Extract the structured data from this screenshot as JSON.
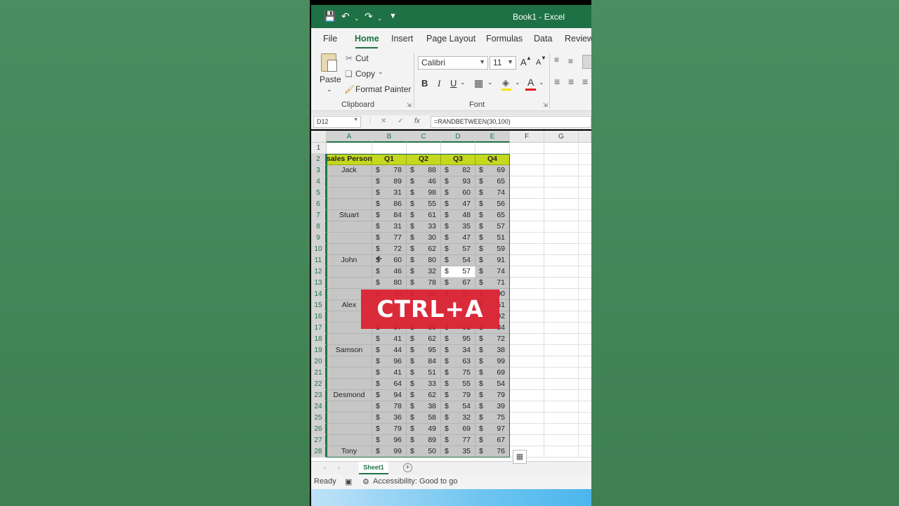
{
  "window": {
    "title": "Book1  -  Excel"
  },
  "quick_access": {
    "save_icon": "save-icon",
    "undo_icon": "undo-icon",
    "redo_icon": "redo-icon",
    "customize_icon": "customize-icon"
  },
  "tabs": [
    "File",
    "Home",
    "Insert",
    "Page Layout",
    "Formulas",
    "Data",
    "Review"
  ],
  "active_tab": "Home",
  "ribbon": {
    "clipboard": {
      "paste": "Paste",
      "cut": "Cut",
      "copy": "Copy",
      "format_painter": "Format Painter",
      "label": "Clipboard"
    },
    "font": {
      "font_name": "Calibri",
      "font_size": "11",
      "bold": "B",
      "italic": "I",
      "underline": "U",
      "grow": "A",
      "shrink": "A",
      "font_color_letter": "A",
      "label": "Font"
    }
  },
  "formula_bar": {
    "name_box": "D12",
    "formula": "=RANDBETWEEN(30,100)"
  },
  "columns": [
    "A",
    "B",
    "C",
    "D",
    "E",
    "F",
    "G"
  ],
  "header_row": [
    "sales Person",
    "Q1",
    "Q2",
    "Q3",
    "Q4"
  ],
  "rows": [
    {
      "n": "1",
      "name": "",
      "v": []
    },
    {
      "n": "2",
      "name": "sales Person",
      "v": []
    },
    {
      "n": "3",
      "name": "Jack",
      "v": [
        "78",
        "88",
        "82",
        "69"
      ]
    },
    {
      "n": "4",
      "name": "",
      "v": [
        "89",
        "46",
        "93",
        "65"
      ]
    },
    {
      "n": "5",
      "name": "",
      "v": [
        "31",
        "98",
        "60",
        "74"
      ]
    },
    {
      "n": "6",
      "name": "",
      "v": [
        "86",
        "55",
        "47",
        "56"
      ]
    },
    {
      "n": "7",
      "name": "Stuart",
      "v": [
        "84",
        "61",
        "48",
        "65"
      ]
    },
    {
      "n": "8",
      "name": "",
      "v": [
        "31",
        "33",
        "35",
        "57"
      ]
    },
    {
      "n": "9",
      "name": "",
      "v": [
        "77",
        "30",
        "47",
        "51"
      ]
    },
    {
      "n": "10",
      "name": "",
      "v": [
        "72",
        "62",
        "57",
        "59"
      ]
    },
    {
      "n": "11",
      "name": "John",
      "v": [
        "60",
        "80",
        "54",
        "91"
      ]
    },
    {
      "n": "12",
      "name": "",
      "v": [
        "46",
        "32",
        "57",
        "74"
      ]
    },
    {
      "n": "13",
      "name": "",
      "v": [
        "80",
        "78",
        "67",
        "71"
      ]
    },
    {
      "n": "14",
      "name": "",
      "v": [
        "45",
        "56",
        "80",
        "90"
      ]
    },
    {
      "n": "15",
      "name": "Alex",
      "v": [
        "",
        "",
        "",
        "51"
      ]
    },
    {
      "n": "16",
      "name": "",
      "v": [
        "",
        "",
        "",
        "92"
      ]
    },
    {
      "n": "17",
      "name": "",
      "v": [
        "97",
        "39",
        "91",
        "84"
      ]
    },
    {
      "n": "18",
      "name": "",
      "v": [
        "41",
        "62",
        "95",
        "72"
      ]
    },
    {
      "n": "19",
      "name": "Samson",
      "v": [
        "44",
        "95",
        "34",
        "38"
      ]
    },
    {
      "n": "20",
      "name": "",
      "v": [
        "96",
        "84",
        "63",
        "99"
      ]
    },
    {
      "n": "21",
      "name": "",
      "v": [
        "41",
        "51",
        "75",
        "69"
      ]
    },
    {
      "n": "22",
      "name": "",
      "v": [
        "64",
        "33",
        "55",
        "54"
      ]
    },
    {
      "n": "23",
      "name": "Desmond",
      "v": [
        "94",
        "62",
        "79",
        "79"
      ]
    },
    {
      "n": "24",
      "name": "",
      "v": [
        "78",
        "38",
        "54",
        "39"
      ]
    },
    {
      "n": "25",
      "name": "",
      "v": [
        "36",
        "58",
        "32",
        "75"
      ]
    },
    {
      "n": "26",
      "name": "",
      "v": [
        "79",
        "49",
        "69",
        "97"
      ]
    },
    {
      "n": "27",
      "name": "",
      "v": [
        "96",
        "89",
        "77",
        "67"
      ]
    },
    {
      "n": "28",
      "name": "Tony",
      "v": [
        "99",
        "50",
        "35",
        "76"
      ]
    }
  ],
  "currency_symbol": "$",
  "overlay_text": "CTRL+A",
  "sheet_tab": "Sheet1",
  "status": {
    "ready": "Ready",
    "accessibility": "Accessibility: Good to go"
  },
  "colors": {
    "excel_green": "#1e7145",
    "header_fill": "#c5d81e",
    "selection_fill": "#c6c6c6",
    "overlay_red": "#dc1f30"
  }
}
